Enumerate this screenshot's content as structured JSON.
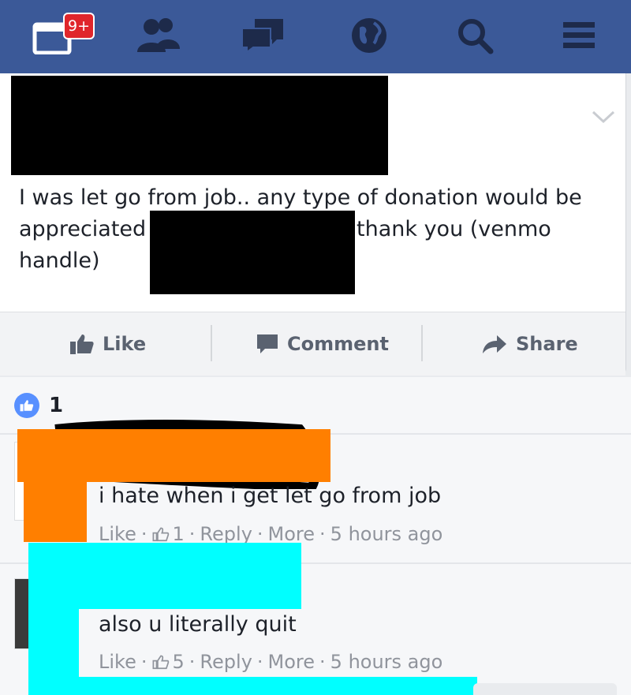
{
  "nav": {
    "notification_badge": "9+",
    "icons": [
      "notifications-icon",
      "friends-icon",
      "messages-icon",
      "globe-icon",
      "search-icon",
      "menu-icon"
    ]
  },
  "post": {
    "text_line1": "I was let go from job.. any type of donation would be",
    "text_line2_start": "appreciated",
    "text_line2_end": "thank you (venmo",
    "text_line3": "handle)"
  },
  "actions": {
    "like": "Like",
    "comment": "Comment",
    "share": "Share"
  },
  "likes": {
    "count": "1"
  },
  "comments": [
    {
      "text": "i hate when i get let go from job",
      "like_label": "Like",
      "reactions": "1",
      "reply_label": "Reply",
      "more_label": "More",
      "time": "5 hours ago"
    },
    {
      "text": "also u literally quit",
      "like_label": "Like",
      "reactions": "5",
      "reply_label": "Reply",
      "more_label": "More",
      "time": "5 hours ago"
    }
  ],
  "colors": {
    "nav_bg": "#3b5998",
    "badge": "#e0262b",
    "like_blue": "#5890ff",
    "redaction_orange": "#ff7f00",
    "redaction_cyan": "#00ffff"
  }
}
